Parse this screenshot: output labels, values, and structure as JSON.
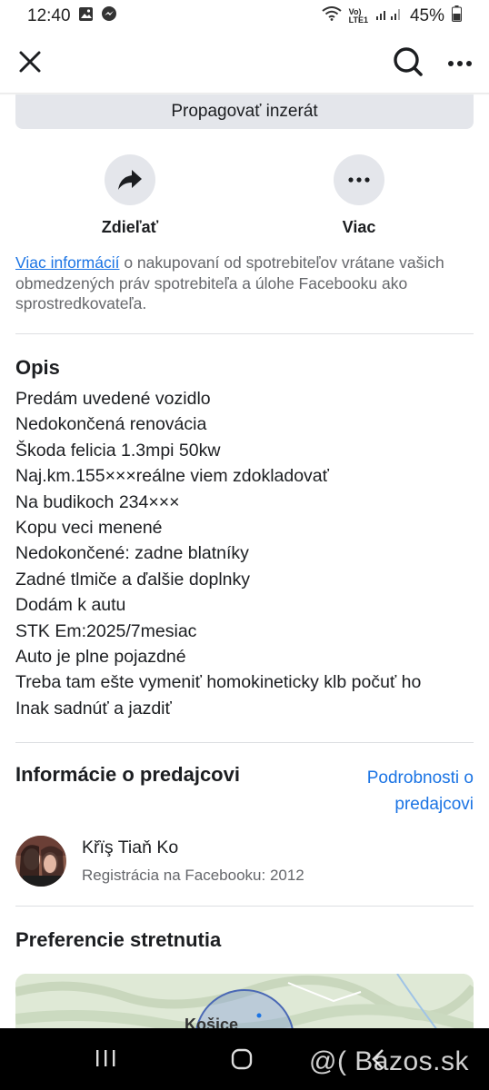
{
  "status": {
    "time": "12:40",
    "battery": "45%",
    "network": "LTE1"
  },
  "header": {
    "close_icon": "close-icon",
    "search_icon": "search-icon",
    "more_icon": "more-horizontal-icon"
  },
  "promote_label": "Propagovať inzerát",
  "actions": {
    "share_label": "Zdieľať",
    "more_label": "Viac"
  },
  "info": {
    "link": "Viac informácií",
    "text": " o nakupovaní od spotrebiteľov vrátane vašich obmedzených práv spotrebiteľa a úlohe Facebooku ako sprostredkovateľa."
  },
  "description": {
    "title": "Opis",
    "lines": [
      "Predám uvedené vozidlo",
      "Nedokončená renovácia",
      "Škoda felicia 1.3mpi 50kw",
      "Naj.km.155×××reálne viem zdokladovať",
      "Na budikoch 234×××",
      "Kopu veci menené",
      "Nedokončené: zadne blatníky",
      "Zadné tlmiče a ďalšie doplnky",
      "Dodám k autu",
      "STK Em:2025/7mesiac",
      "Auto je plne pojazdné",
      "Treba tam ešte vymeniť homokineticky klb počuť ho",
      "Inak sadnúť a jazdiť"
    ]
  },
  "seller": {
    "title": "Informácie o predajcovi",
    "details_link_1": "Podrobnosti o",
    "details_link_2": "predajcovi",
    "name": "Křïş Tiaň Ko",
    "registered": "Registrácia na Facebooku: 2012"
  },
  "meeting": {
    "title": "Preferencie stretnutia",
    "map_city": "Košice"
  },
  "watermark": "@( Bazos.sk",
  "colors": {
    "link": "#1b74e4",
    "button_bg": "#e4e6eb",
    "secondary_text": "#65676b"
  }
}
